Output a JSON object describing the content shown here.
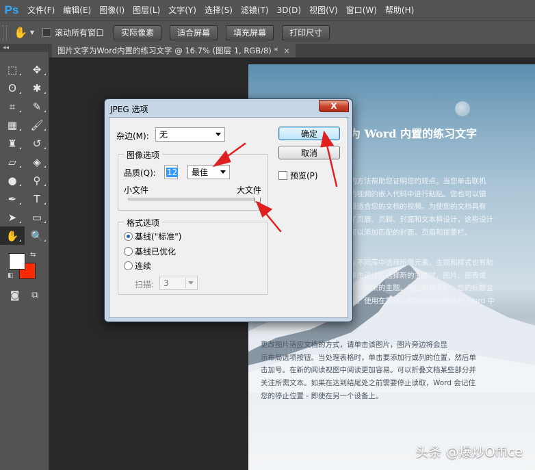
{
  "app": {
    "logo": "Ps"
  },
  "menu": [
    "文件(F)",
    "编辑(E)",
    "图像(I)",
    "图层(L)",
    "文字(Y)",
    "选择(S)",
    "滤镜(T)",
    "3D(D)",
    "视图(V)",
    "窗口(W)",
    "帮助(H)"
  ],
  "options_bar": {
    "tool_icon": "hand-icon",
    "scroll_all_label": "滚动所有窗口",
    "buttons": [
      "实际像素",
      "适合屏幕",
      "填充屏幕",
      "打印尺寸"
    ]
  },
  "toolbar": {
    "collapse": "◂◂",
    "tools": [
      {
        "name": "marquee",
        "glyph": "⬚"
      },
      {
        "name": "move",
        "glyph": "✥"
      },
      {
        "name": "lasso",
        "glyph": "ʘ"
      },
      {
        "name": "magic-wand",
        "glyph": "✱"
      },
      {
        "name": "crop",
        "glyph": "⌗"
      },
      {
        "name": "eyedropper",
        "glyph": "✎"
      },
      {
        "name": "healing",
        "glyph": "▦"
      },
      {
        "name": "brush",
        "glyph": "🖌"
      },
      {
        "name": "stamp",
        "glyph": "♜"
      },
      {
        "name": "history-brush",
        "glyph": "↺"
      },
      {
        "name": "eraser",
        "glyph": "▱"
      },
      {
        "name": "paint-bucket",
        "glyph": "◈"
      },
      {
        "name": "blur",
        "glyph": "●"
      },
      {
        "name": "dodge",
        "glyph": "⚲"
      },
      {
        "name": "pen",
        "glyph": "✒"
      },
      {
        "name": "type",
        "glyph": "T"
      },
      {
        "name": "path-select",
        "glyph": "➤"
      },
      {
        "name": "shape",
        "glyph": "▭"
      },
      {
        "name": "hand",
        "glyph": "✋"
      },
      {
        "name": "zoom",
        "glyph": "🔍"
      }
    ],
    "fg_color": "#ffffff",
    "bg_color": "#ff2a00"
  },
  "document": {
    "tab_title": "图片文字为Word内置的练习文字 @ 16.7% (图层 1, RGB/8) *",
    "tab_close": "×",
    "heading": "为 Word 内置的练习文字",
    "para1": "的方法帮助您证明您的观点。当您单击联机\n的视频的嵌入代码中进行粘贴。您也可以键\n最适合您的文档的视频。为使您的文档具有\n了页眉、页脚、封面和文本框设计，这些设计\n可以添加匹配的封面、页眉和提要栏。",
    "para2": "从不同库中选择所需元素。主题和样式也有助\n单击设计并选择新的主题时，图片、图表或\n以匹配新的主题。当应用样式时，您的标题会\n题。使用在需要位置出现的新按钮在 Word 中",
    "para3": "更改图片适应文档的方式，请单击该图片，图片旁边将会显\n示布局选项按钮。当处理表格时，单击要添加行或列的位置，然后单\n击加号。在新的阅读视图中阅读更加容易。可以折叠文档某些部分并\n关注所需文本。如果在达到结尾处之前需要停止读取，Word 会记住\n您的停止位置 - 即使在另一个设备上。"
  },
  "dialog": {
    "title": "JPEG 选项",
    "close_label": "X",
    "matte_label": "杂边(M):",
    "matte_value": "无",
    "image_options": {
      "legend": "图像选项",
      "quality_label": "品质(Q):",
      "quality_value": "12",
      "quality_preset": "最佳",
      "small_file": "小文件",
      "large_file": "大文件",
      "slider_fraction": 1.0
    },
    "format_options": {
      "legend": "格式选项",
      "baseline_standard": "基线(\"标准\")",
      "baseline_optimized": "基线已优化",
      "progressive": "连续",
      "scans_label": "扫描:",
      "scans_value": "3",
      "selected": "baseline_standard"
    },
    "ok_label": "确定",
    "cancel_label": "取消",
    "preview_label": "预览(P)"
  },
  "watermark": "头条 @爆炒Office",
  "annotation_color": "#e02020"
}
